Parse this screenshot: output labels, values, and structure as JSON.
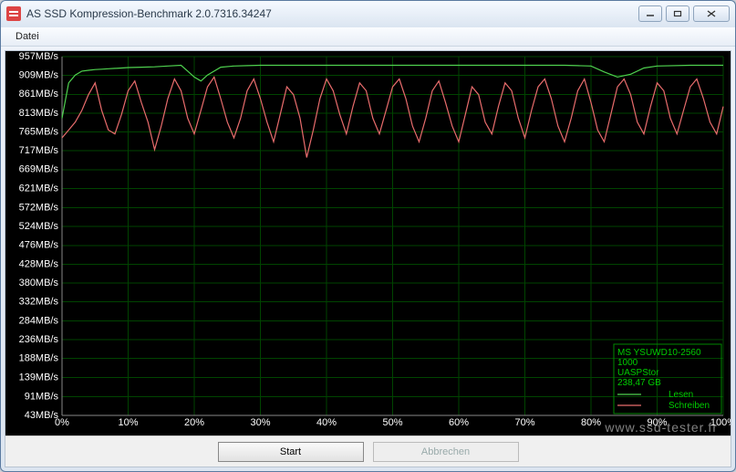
{
  "window": {
    "title": "AS SSD Kompression-Benchmark 2.0.7316.34247"
  },
  "menu": {
    "file": "Datei"
  },
  "buttons": {
    "start": "Start",
    "abort": "Abbrechen"
  },
  "legend": {
    "device_line1": "MS YSUWD10-2560",
    "device_line2": "1000",
    "driver": "UASPStor",
    "capacity": "238,47 GB",
    "read": "Lesen",
    "write": "Schreiben"
  },
  "watermark": "www.ssd-tester.fr",
  "chart_data": {
    "type": "line",
    "xlabel": "",
    "ylabel": "",
    "y_unit": "MB/s",
    "ylim": [
      43,
      957
    ],
    "xlim": [
      0,
      100
    ],
    "x_ticks": [
      0,
      10,
      20,
      30,
      40,
      50,
      60,
      70,
      80,
      90,
      100
    ],
    "y_ticks": [
      43,
      91,
      139,
      188,
      236,
      284,
      332,
      380,
      428,
      476,
      524,
      572,
      621,
      669,
      717,
      765,
      813,
      861,
      909,
      957
    ],
    "series": [
      {
        "name": "Lesen",
        "color": "#4fd14f",
        "x": [
          0,
          1,
          2,
          3,
          4,
          5,
          6,
          7,
          8,
          9,
          10,
          12,
          14,
          16,
          18,
          19,
          20,
          21,
          22,
          24,
          26,
          28,
          30,
          40,
          50,
          60,
          70,
          76,
          78,
          80,
          82,
          84,
          86,
          88,
          90,
          95,
          100
        ],
        "values": [
          800,
          890,
          910,
          920,
          922,
          924,
          925,
          926,
          927,
          928,
          929,
          930,
          931,
          933,
          935,
          920,
          905,
          895,
          910,
          930,
          933,
          934,
          935,
          935,
          935,
          935,
          935,
          935,
          934,
          933,
          918,
          905,
          912,
          928,
          933,
          935,
          935
        ]
      },
      {
        "name": "Schreiben",
        "color": "#e86c6c",
        "x": [
          0,
          1,
          2,
          3,
          4,
          5,
          6,
          7,
          8,
          9,
          10,
          11,
          12,
          13,
          14,
          15,
          16,
          17,
          18,
          19,
          20,
          21,
          22,
          23,
          24,
          25,
          26,
          27,
          28,
          29,
          30,
          31,
          32,
          33,
          34,
          35,
          36,
          37,
          38,
          39,
          40,
          41,
          42,
          43,
          44,
          45,
          46,
          47,
          48,
          49,
          50,
          51,
          52,
          53,
          54,
          55,
          56,
          57,
          58,
          59,
          60,
          61,
          62,
          63,
          64,
          65,
          66,
          67,
          68,
          69,
          70,
          71,
          72,
          73,
          74,
          75,
          76,
          77,
          78,
          79,
          80,
          81,
          82,
          83,
          84,
          85,
          86,
          87,
          88,
          89,
          90,
          91,
          92,
          93,
          94,
          95,
          96,
          97,
          98,
          99,
          100
        ],
        "values": [
          750,
          770,
          790,
          820,
          860,
          890,
          820,
          770,
          760,
          810,
          870,
          895,
          840,
          790,
          720,
          780,
          850,
          900,
          870,
          800,
          760,
          820,
          880,
          905,
          850,
          790,
          750,
          800,
          870,
          900,
          850,
          790,
          740,
          810,
          880,
          860,
          800,
          700,
          770,
          850,
          900,
          870,
          810,
          760,
          830,
          890,
          870,
          800,
          760,
          820,
          880,
          900,
          850,
          780,
          740,
          800,
          870,
          895,
          840,
          780,
          740,
          810,
          880,
          860,
          790,
          760,
          830,
          890,
          870,
          800,
          750,
          820,
          880,
          900,
          850,
          780,
          740,
          800,
          870,
          900,
          840,
          770,
          740,
          810,
          880,
          900,
          860,
          790,
          760,
          830,
          890,
          870,
          800,
          760,
          820,
          880,
          900,
          850,
          790,
          760,
          830
        ]
      }
    ]
  }
}
